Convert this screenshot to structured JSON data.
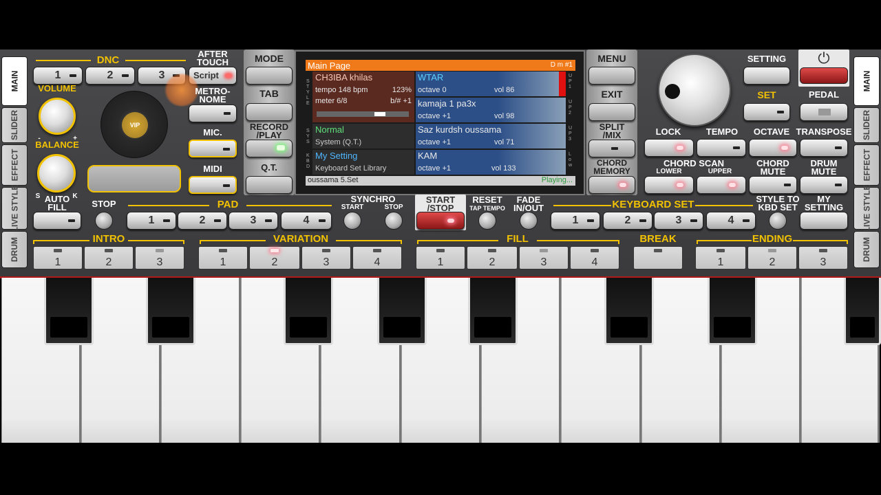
{
  "side_tabs_left": [
    "MAIN",
    "SLIDER",
    "EFFECT",
    "LIVE STYLE",
    "DRUM"
  ],
  "side_tabs_right": [
    "MAIN",
    "SLIDER",
    "EFFECT",
    "LIVE STYLE",
    "DRUM"
  ],
  "dnc": {
    "label": "DNC",
    "buttons": [
      "1",
      "2",
      "3"
    ],
    "script_label": "Script"
  },
  "after_touch": "AFTER\nTOUCH",
  "metronome": "METRO-\nNOME",
  "mic": "MIC.",
  "midi": "MIDI",
  "volume": "VOLUME",
  "balance": "BALANCE",
  "balance_marks": {
    "minus": "-",
    "plus": "+",
    "s": "S",
    "k": "K"
  },
  "vip": "VIP",
  "mode": "MODE",
  "tab": "TAB",
  "record_play": "RECORD\n/PLAY",
  "qt": "Q.T.",
  "menu": "MENU",
  "exit": "EXIT",
  "split_mix": "SPLIT\n/MIX",
  "chord_memory": "CHORD\nMEMORY",
  "setting": "SETTING",
  "set": "SET",
  "pedal": "PEDAL",
  "lock": "LOCK",
  "tempo": "TEMPO",
  "octave": "OCTAVE",
  "transpose": "TRANSPOSE",
  "chord_scan": "CHORD SCAN",
  "lower": "LOWER",
  "upper": "UPPER",
  "chord_mute": "CHORD\nMUTE",
  "drum_mute": "DRUM\nMUTE",
  "screen": {
    "header": "Main Page",
    "chord": "D m #1",
    "style": {
      "name": "CH3IBA khilas",
      "tempo": "tempo 148 bpm",
      "percent": "123%",
      "meter": "meter 6/8",
      "key": "b/# +1"
    },
    "sys": {
      "name": "Normal",
      "sub": "System (Q.T.)"
    },
    "kbd": {
      "name": "My Setting",
      "sub": "Keyboard Set Library"
    },
    "parts": [
      {
        "name": "WTAR",
        "octave": "octave  0",
        "vol": "vol 86",
        "tag": "U P 1"
      },
      {
        "name": "kamaja 1 pa3x",
        "octave": "octave +1",
        "vol": "vol 98",
        "tag": "U P 2"
      },
      {
        "name": "Saz kurdsh  oussama",
        "octave": "octave +1",
        "vol": "vol 71",
        "tag": "U P 3"
      },
      {
        "name": "KAM",
        "octave": "octave +1",
        "vol": "vol 133",
        "tag": "L o w"
      }
    ],
    "side_labels": {
      "style": "S T Y L E",
      "sys": "S Y S",
      "kbd": "K B D"
    },
    "footer_file": "oussama 5.Set",
    "footer_status": "Playing..."
  },
  "stop": "STOP",
  "auto_fill": "AUTO\nFILL",
  "pad": {
    "label": "PAD",
    "buttons": [
      "1",
      "2",
      "3",
      "4"
    ]
  },
  "synchro": {
    "label": "SYNCHRO",
    "start": "START",
    "stop": "STOP"
  },
  "start_stop": "START\n/STOP",
  "reset": "RESET",
  "tap_tempo": "TAP TEMPO",
  "fade": "FADE\nIN/OUT",
  "keyboard_set": {
    "label": "KEYBOARD SET",
    "buttons": [
      "1",
      "2",
      "3",
      "4"
    ]
  },
  "style_to_kbd": "STYLE TO\nKBD SET",
  "my_setting": "MY\nSETTING",
  "intro": {
    "label": "INTRO",
    "buttons": [
      "1",
      "2",
      "3"
    ]
  },
  "variation": {
    "label": "VARIATION",
    "buttons": [
      "1",
      "2",
      "3",
      "4"
    ]
  },
  "fill": {
    "label": "FILL",
    "buttons": [
      "1",
      "2",
      "3",
      "4"
    ]
  },
  "break": {
    "label": "BREAK"
  },
  "ending": {
    "label": "ENDING",
    "buttons": [
      "1",
      "2",
      "3"
    ]
  }
}
